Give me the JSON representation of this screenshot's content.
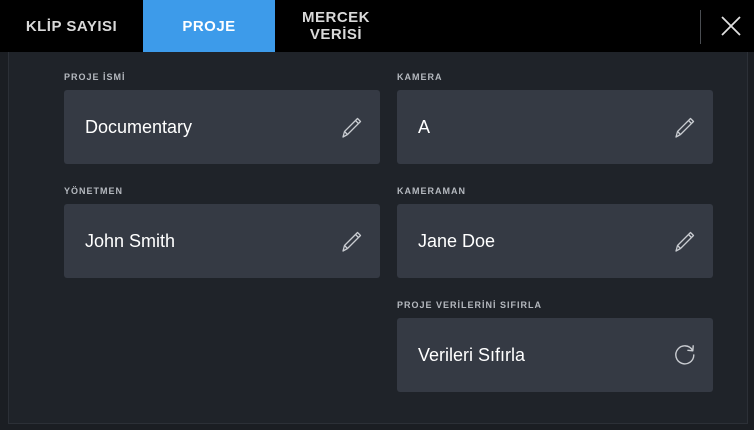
{
  "tabs": [
    {
      "label": "KLİP SAYISI",
      "active": false
    },
    {
      "label": "PROJE",
      "active": true
    },
    {
      "label_line1": "MERCEK",
      "label_line2": "VERİSİ",
      "active": false
    }
  ],
  "close_icon": "close-icon",
  "fields": {
    "project_name": {
      "label": "PROJE İSMİ",
      "value": "Documentary",
      "icon": "pencil-icon"
    },
    "camera": {
      "label": "KAMERA",
      "value": "A",
      "icon": "pencil-icon"
    },
    "director": {
      "label": "YÖNETMEN",
      "value": "John Smith",
      "icon": "pencil-icon"
    },
    "camera_operator": {
      "label": "KAMERAMAN",
      "value": "Jane Doe",
      "icon": "pencil-icon"
    },
    "reset": {
      "label": "PROJE VERİLERİNİ SIFIRLA",
      "value": "Verileri Sıfırla",
      "icon": "refresh-icon"
    }
  },
  "colors": {
    "accent": "#3d9bea",
    "field_bg": "#353a44",
    "background": "#1f2329"
  }
}
